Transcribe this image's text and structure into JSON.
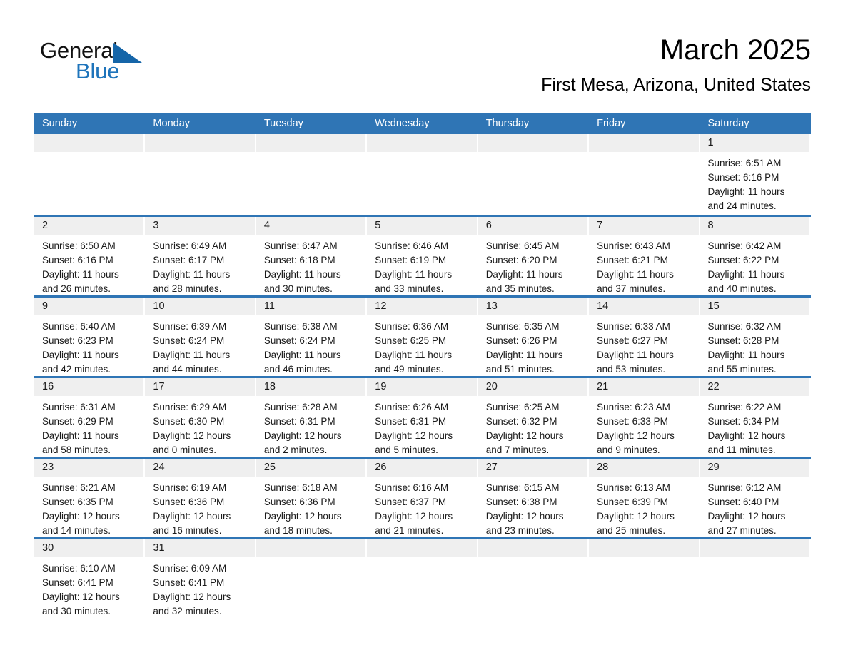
{
  "brand": {
    "word_one": "General",
    "word_two": "Blue",
    "triangle_color": "#1565a8",
    "blue_text_color": "#1e74bb"
  },
  "header": {
    "title": "March 2025",
    "subtitle": "First Mesa, Arizona, United States"
  },
  "theme": {
    "header_blue": "#2f75b5",
    "daynum_band": "#efefef",
    "text": "#1a1a1a"
  },
  "weekdays": [
    "Sunday",
    "Monday",
    "Tuesday",
    "Wednesday",
    "Thursday",
    "Friday",
    "Saturday"
  ],
  "weeks": [
    [
      {
        "day": "",
        "lines": []
      },
      {
        "day": "",
        "lines": []
      },
      {
        "day": "",
        "lines": []
      },
      {
        "day": "",
        "lines": []
      },
      {
        "day": "",
        "lines": []
      },
      {
        "day": "",
        "lines": []
      },
      {
        "day": "1",
        "lines": [
          "Sunrise: 6:51 AM",
          "Sunset: 6:16 PM",
          "Daylight: 11 hours",
          "and 24 minutes."
        ]
      }
    ],
    [
      {
        "day": "2",
        "lines": [
          "Sunrise: 6:50 AM",
          "Sunset: 6:16 PM",
          "Daylight: 11 hours",
          "and 26 minutes."
        ]
      },
      {
        "day": "3",
        "lines": [
          "Sunrise: 6:49 AM",
          "Sunset: 6:17 PM",
          "Daylight: 11 hours",
          "and 28 minutes."
        ]
      },
      {
        "day": "4",
        "lines": [
          "Sunrise: 6:47 AM",
          "Sunset: 6:18 PM",
          "Daylight: 11 hours",
          "and 30 minutes."
        ]
      },
      {
        "day": "5",
        "lines": [
          "Sunrise: 6:46 AM",
          "Sunset: 6:19 PM",
          "Daylight: 11 hours",
          "and 33 minutes."
        ]
      },
      {
        "day": "6",
        "lines": [
          "Sunrise: 6:45 AM",
          "Sunset: 6:20 PM",
          "Daylight: 11 hours",
          "and 35 minutes."
        ]
      },
      {
        "day": "7",
        "lines": [
          "Sunrise: 6:43 AM",
          "Sunset: 6:21 PM",
          "Daylight: 11 hours",
          "and 37 minutes."
        ]
      },
      {
        "day": "8",
        "lines": [
          "Sunrise: 6:42 AM",
          "Sunset: 6:22 PM",
          "Daylight: 11 hours",
          "and 40 minutes."
        ]
      }
    ],
    [
      {
        "day": "9",
        "lines": [
          "Sunrise: 6:40 AM",
          "Sunset: 6:23 PM",
          "Daylight: 11 hours",
          "and 42 minutes."
        ]
      },
      {
        "day": "10",
        "lines": [
          "Sunrise: 6:39 AM",
          "Sunset: 6:24 PM",
          "Daylight: 11 hours",
          "and 44 minutes."
        ]
      },
      {
        "day": "11",
        "lines": [
          "Sunrise: 6:38 AM",
          "Sunset: 6:24 PM",
          "Daylight: 11 hours",
          "and 46 minutes."
        ]
      },
      {
        "day": "12",
        "lines": [
          "Sunrise: 6:36 AM",
          "Sunset: 6:25 PM",
          "Daylight: 11 hours",
          "and 49 minutes."
        ]
      },
      {
        "day": "13",
        "lines": [
          "Sunrise: 6:35 AM",
          "Sunset: 6:26 PM",
          "Daylight: 11 hours",
          "and 51 minutes."
        ]
      },
      {
        "day": "14",
        "lines": [
          "Sunrise: 6:33 AM",
          "Sunset: 6:27 PM",
          "Daylight: 11 hours",
          "and 53 minutes."
        ]
      },
      {
        "day": "15",
        "lines": [
          "Sunrise: 6:32 AM",
          "Sunset: 6:28 PM",
          "Daylight: 11 hours",
          "and 55 minutes."
        ]
      }
    ],
    [
      {
        "day": "16",
        "lines": [
          "Sunrise: 6:31 AM",
          "Sunset: 6:29 PM",
          "Daylight: 11 hours",
          "and 58 minutes."
        ]
      },
      {
        "day": "17",
        "lines": [
          "Sunrise: 6:29 AM",
          "Sunset: 6:30 PM",
          "Daylight: 12 hours",
          "and 0 minutes."
        ]
      },
      {
        "day": "18",
        "lines": [
          "Sunrise: 6:28 AM",
          "Sunset: 6:31 PM",
          "Daylight: 12 hours",
          "and 2 minutes."
        ]
      },
      {
        "day": "19",
        "lines": [
          "Sunrise: 6:26 AM",
          "Sunset: 6:31 PM",
          "Daylight: 12 hours",
          "and 5 minutes."
        ]
      },
      {
        "day": "20",
        "lines": [
          "Sunrise: 6:25 AM",
          "Sunset: 6:32 PM",
          "Daylight: 12 hours",
          "and 7 minutes."
        ]
      },
      {
        "day": "21",
        "lines": [
          "Sunrise: 6:23 AM",
          "Sunset: 6:33 PM",
          "Daylight: 12 hours",
          "and 9 minutes."
        ]
      },
      {
        "day": "22",
        "lines": [
          "Sunrise: 6:22 AM",
          "Sunset: 6:34 PM",
          "Daylight: 12 hours",
          "and 11 minutes."
        ]
      }
    ],
    [
      {
        "day": "23",
        "lines": [
          "Sunrise: 6:21 AM",
          "Sunset: 6:35 PM",
          "Daylight: 12 hours",
          "and 14 minutes."
        ]
      },
      {
        "day": "24",
        "lines": [
          "Sunrise: 6:19 AM",
          "Sunset: 6:36 PM",
          "Daylight: 12 hours",
          "and 16 minutes."
        ]
      },
      {
        "day": "25",
        "lines": [
          "Sunrise: 6:18 AM",
          "Sunset: 6:36 PM",
          "Daylight: 12 hours",
          "and 18 minutes."
        ]
      },
      {
        "day": "26",
        "lines": [
          "Sunrise: 6:16 AM",
          "Sunset: 6:37 PM",
          "Daylight: 12 hours",
          "and 21 minutes."
        ]
      },
      {
        "day": "27",
        "lines": [
          "Sunrise: 6:15 AM",
          "Sunset: 6:38 PM",
          "Daylight: 12 hours",
          "and 23 minutes."
        ]
      },
      {
        "day": "28",
        "lines": [
          "Sunrise: 6:13 AM",
          "Sunset: 6:39 PM",
          "Daylight: 12 hours",
          "and 25 minutes."
        ]
      },
      {
        "day": "29",
        "lines": [
          "Sunrise: 6:12 AM",
          "Sunset: 6:40 PM",
          "Daylight: 12 hours",
          "and 27 minutes."
        ]
      }
    ],
    [
      {
        "day": "30",
        "lines": [
          "Sunrise: 6:10 AM",
          "Sunset: 6:41 PM",
          "Daylight: 12 hours",
          "and 30 minutes."
        ]
      },
      {
        "day": "31",
        "lines": [
          "Sunrise: 6:09 AM",
          "Sunset: 6:41 PM",
          "Daylight: 12 hours",
          "and 32 minutes."
        ]
      },
      {
        "day": "",
        "lines": []
      },
      {
        "day": "",
        "lines": []
      },
      {
        "day": "",
        "lines": []
      },
      {
        "day": "",
        "lines": []
      },
      {
        "day": "",
        "lines": []
      }
    ]
  ]
}
